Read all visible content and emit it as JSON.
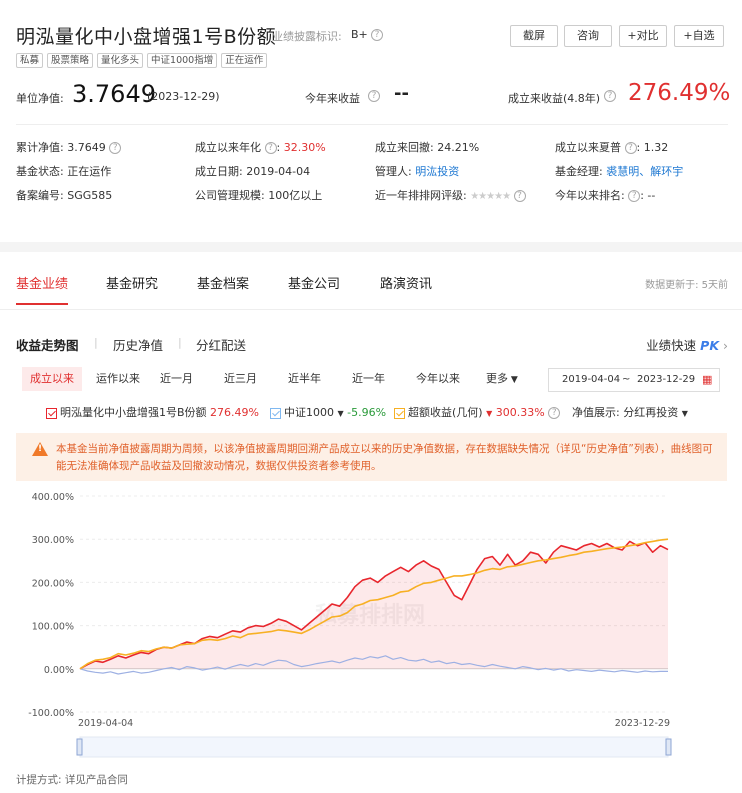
{
  "header": {
    "fund_name": "明泓量化中小盘增强1号B份额",
    "disclose_label": "业绩披露标识:",
    "disclose_value": "B+",
    "buttons": [
      "截屏",
      "咨询",
      "+对比",
      "+自选"
    ],
    "tags": [
      "私募",
      "股票策略",
      "量化多头",
      "中证1000指增",
      "正在运作"
    ]
  },
  "summary": {
    "nav_label": "单位净值:",
    "nav_value": "3.7649",
    "nav_date": "(2023-12-29)",
    "ytd_label": "今年来收益",
    "ytd_value": "--",
    "since_label": "成立来收益(4.8年)",
    "since_value": "276.49%"
  },
  "info": {
    "cum_nav_label": "累计净值:",
    "cum_nav_value": "3.7649",
    "annual_label": "成立以来年化",
    "annual_value": "32.30%",
    "drawdown_label": "成立来回撤:",
    "drawdown_value": "24.21%",
    "sharpe_label": "成立以来夏普",
    "sharpe_value": "1.32",
    "status_label": "基金状态:",
    "status_value": "正在运作",
    "setup_label": "成立日期:",
    "setup_value": "2019-04-04",
    "manager_label": "管理人:",
    "manager_value": "明汯投资",
    "fm_label": "基金经理:",
    "fm_value": "裘慧明、解环宇",
    "record_label": "备案编号:",
    "record_value": "SGG585",
    "scale_label": "公司管理规模:",
    "scale_value": "100亿以上",
    "rating_label": "近一年排排网评级:",
    "rating_stars": "★★★★★",
    "rank_label": "今年以来排名:",
    "rank_value": "--"
  },
  "tabs": [
    "基金业绩",
    "基金研究",
    "基金档案",
    "基金公司",
    "路演资讯"
  ],
  "update_note": "数据更新于: 5天前",
  "subtabs": [
    "收益走势图",
    "历史净值",
    "分红配送"
  ],
  "pk_label": "业绩快速",
  "pk_badge": "PK",
  "ranges": [
    "成立以来",
    "运作以来",
    "近一月",
    "近三月",
    "近半年",
    "近一年",
    "今年以来",
    "更多"
  ],
  "date_range": {
    "start": "2019-04-04",
    "sep": "~",
    "end": "2023-12-29"
  },
  "legend": {
    "fund_name": "明泓量化中小盘增强1号B份额",
    "fund_value": "276.49%",
    "index_name": "中证1000",
    "index_value": "-5.96%",
    "excess_name": "超额收益(几何)",
    "excess_value": "300.33%",
    "nav_display_label": "净值展示:",
    "nav_display_value": "分红再投资"
  },
  "warning": "本基金当前净值披露周期为周频，以该净值披露周期回溯产品成立以来的历史净值数据，存在数据缺失情况（详见“历史净值”列表），曲线图可能无法准确体现产品收益及回撤波动情况，数据仅供投资者参考使用。",
  "watermark": "私募排排网",
  "footer": "计提方式: 详见产品合同",
  "colors": {
    "fund": "#e8262d",
    "index": "#9db0e3",
    "excess": "#f7b023",
    "accent": "#e03030"
  },
  "chart_data": {
    "type": "line",
    "x_start": "2019-04-04",
    "x_end": "2023-12-29",
    "ylim": [
      -100,
      400
    ],
    "yticks": [
      "400.00%",
      "300.00%",
      "200.00%",
      "100.00%",
      "0.00%",
      "-100.00%"
    ],
    "xtick_labels": [
      "2019-04-04",
      "2023-12-29"
    ],
    "series": [
      {
        "name": "明泓量化中小盘增强1号B份额",
        "color": "#e8262d",
        "values": [
          0,
          10,
          18,
          15,
          22,
          30,
          25,
          32,
          38,
          35,
          45,
          50,
          48,
          55,
          62,
          58,
          70,
          75,
          72,
          80,
          88,
          85,
          95,
          100,
          98,
          105,
          115,
          110,
          100,
          90,
          105,
          120,
          135,
          150,
          145,
          165,
          190,
          205,
          210,
          200,
          215,
          225,
          235,
          225,
          240,
          250,
          238,
          230,
          200,
          170,
          160,
          195,
          230,
          255,
          260,
          240,
          265,
          240,
          250,
          270,
          265,
          245,
          270,
          285,
          280,
          275,
          285,
          290,
          282,
          290,
          280,
          275,
          295,
          285,
          292,
          270,
          285,
          276
        ]
      },
      {
        "name": "中证1000",
        "color": "#9db0e3",
        "values": [
          0,
          -5,
          -8,
          -10,
          -7,
          -12,
          -9,
          -6,
          -10,
          -8,
          -4,
          0,
          3,
          -2,
          5,
          2,
          -3,
          0,
          4,
          -1,
          5,
          10,
          6,
          12,
          8,
          15,
          20,
          18,
          10,
          5,
          8,
          12,
          15,
          18,
          14,
          20,
          25,
          22,
          28,
          25,
          30,
          22,
          26,
          20,
          18,
          22,
          15,
          18,
          12,
          15,
          10,
          12,
          8,
          5,
          10,
          6,
          3,
          0,
          5,
          2,
          -2,
          1,
          -3,
          0,
          -5,
          -2,
          -4,
          -6,
          -3,
          -5,
          -7,
          -4,
          -6,
          -8,
          -5,
          -7,
          -6,
          -6
        ]
      },
      {
        "name": "超额收益(几何)",
        "color": "#f7b023",
        "values": [
          0,
          12,
          20,
          22,
          26,
          35,
          32,
          36,
          42,
          40,
          46,
          50,
          48,
          55,
          57,
          58,
          66,
          68,
          66,
          70,
          76,
          72,
          80,
          82,
          84,
          86,
          90,
          88,
          85,
          82,
          90,
          100,
          110,
          120,
          122,
          130,
          145,
          150,
          158,
          160,
          165,
          170,
          178,
          180,
          190,
          198,
          200,
          205,
          210,
          215,
          215,
          218,
          222,
          228,
          232,
          230,
          236,
          238,
          242,
          246,
          250,
          252,
          255,
          258,
          262,
          265,
          270,
          272,
          275,
          278,
          280,
          282,
          285,
          288,
          292,
          295,
          298,
          300
        ]
      }
    ]
  }
}
